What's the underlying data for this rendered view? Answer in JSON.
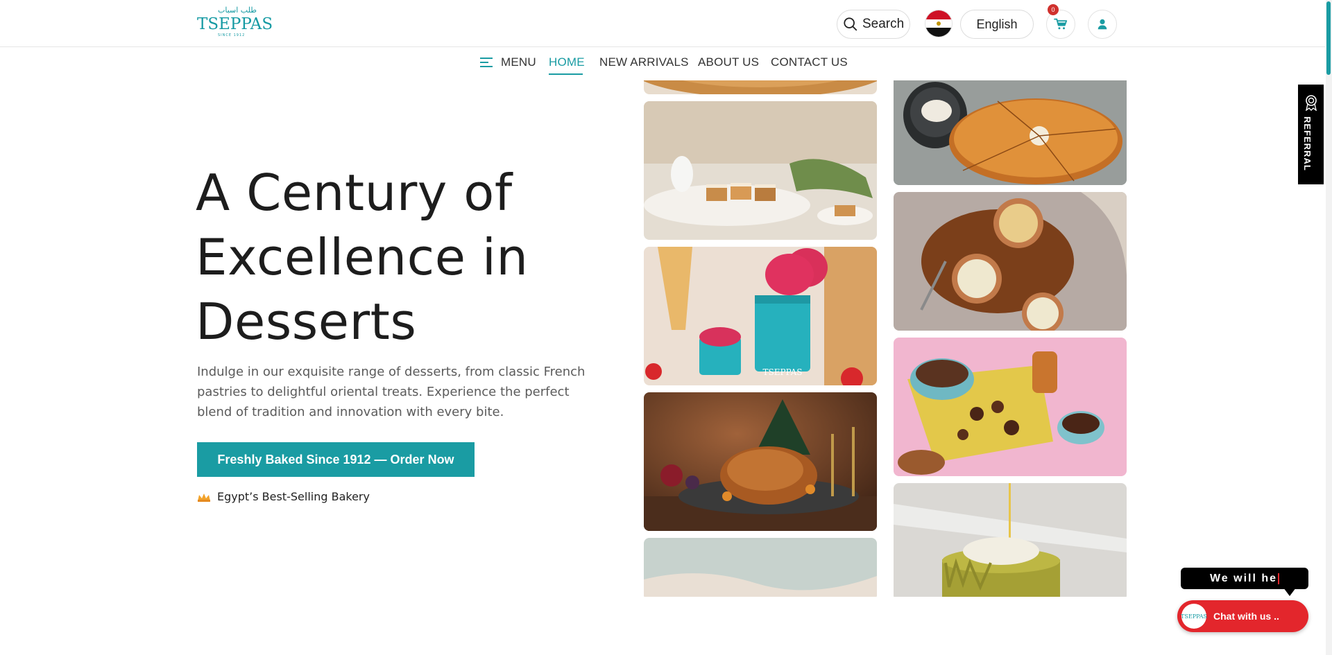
{
  "header": {
    "logo": {
      "arabic": "طلب اسباب",
      "brand": "TSEPPAS",
      "since": "SINCE 1912"
    },
    "search_label": "Search",
    "language_label": "English",
    "cart_count": "0"
  },
  "nav": {
    "menu_label": "MENU",
    "items": [
      {
        "label": "HOME"
      },
      {
        "label": "NEW ARRIVALS"
      },
      {
        "label": "ABOUT US"
      },
      {
        "label": "CONTACT US"
      }
    ],
    "active": "HOME"
  },
  "hero": {
    "headline": "A Century of Excellence in Desserts",
    "subtext": "Indulge in our exquisite range of desserts, from classic French pastries to delightful oriental treats. Experience the perfect blend of tradition and innovation with every bite.",
    "cta_label": "Freshly Baked Since 1912 — Order Now",
    "badge_text": "Egypt’s Best-Selling Bakery"
  },
  "referral": {
    "label": "REFERRAL"
  },
  "chat": {
    "tooltip_text": "We will he",
    "button_label": "Chat with us .."
  },
  "colors": {
    "accent": "#1a9ca3",
    "chat_red": "#e3262c",
    "text": "#1d1d1d"
  },
  "icons": [
    "search-icon",
    "egypt-flag-icon",
    "cart-icon",
    "user-icon",
    "hamburger-icon",
    "crown-icon",
    "award-icon"
  ]
}
